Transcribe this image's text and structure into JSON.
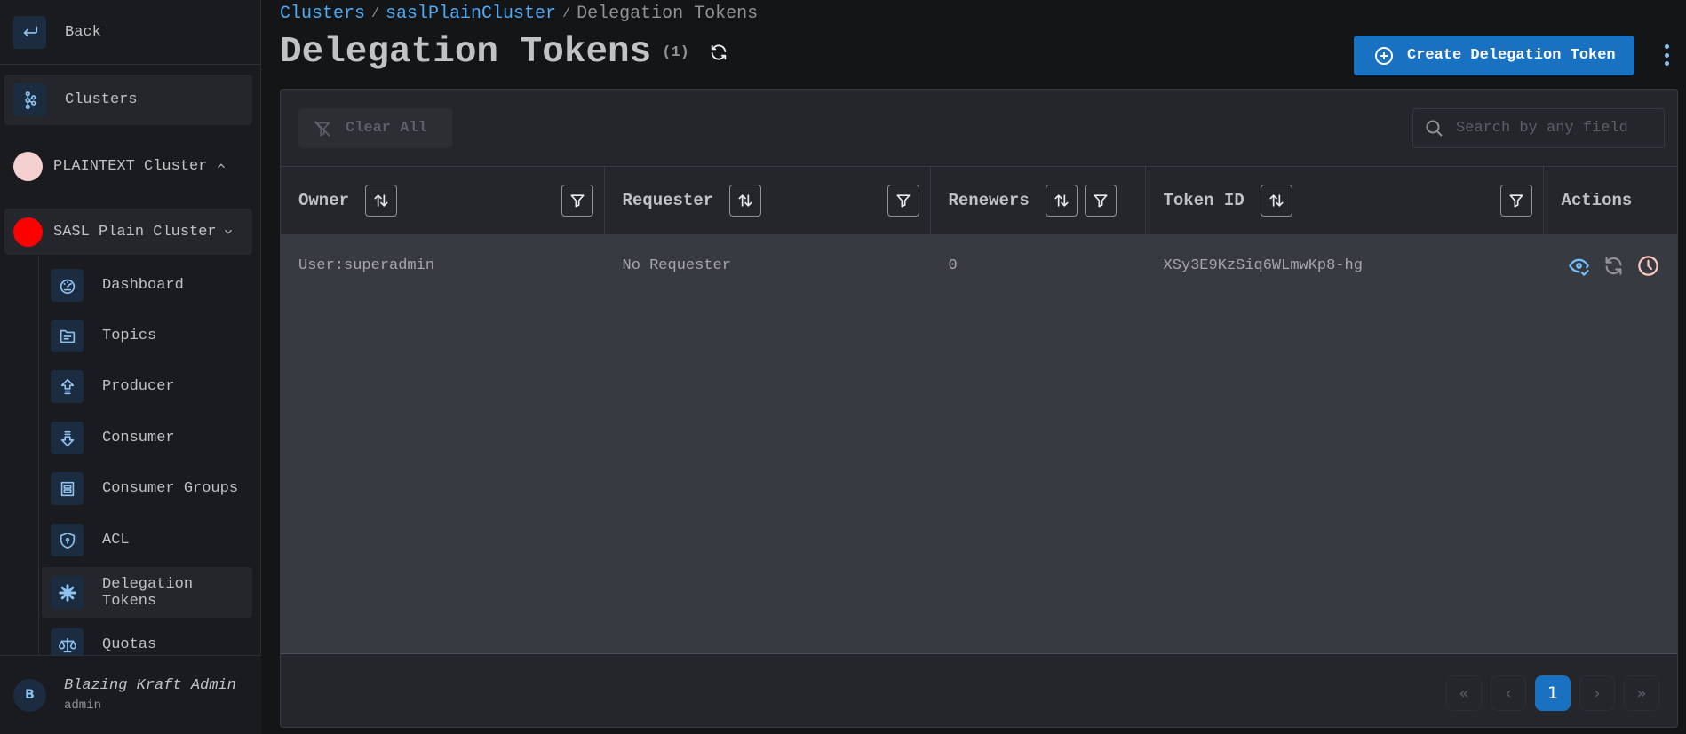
{
  "sidebar": {
    "back_label": "Back",
    "clusters_label": "Clusters",
    "clusters": [
      {
        "name": "PLAINTEXT Cluster",
        "color": "#f5d0d0",
        "expanded": false
      },
      {
        "name": "SASL Plain Cluster",
        "color": "#ff0000",
        "expanded": true
      }
    ],
    "items": [
      {
        "label": "Dashboard",
        "icon": "dashboard-icon"
      },
      {
        "label": "Topics",
        "icon": "folder-icon"
      },
      {
        "label": "Producer",
        "icon": "arrow-up-icon"
      },
      {
        "label": "Consumer",
        "icon": "arrow-down-icon"
      },
      {
        "label": "Consumer Groups",
        "icon": "container-icon"
      },
      {
        "label": "ACL",
        "icon": "shield-lock-icon"
      },
      {
        "label": "Delegation Tokens",
        "icon": "asterisk-icon",
        "active": true
      },
      {
        "label": "Quotas",
        "icon": "scale-icon"
      }
    ],
    "user": {
      "initial": "B",
      "name": "Blazing Kraft Admin",
      "role": "admin"
    }
  },
  "header": {
    "breadcrumb": [
      {
        "label": "Clusters",
        "link": true
      },
      {
        "label": "saslPlainCluster",
        "link": true
      },
      {
        "label": "Delegation Tokens",
        "link": false
      }
    ],
    "separator": "/",
    "title": "Delegation Tokens",
    "count": "(1)",
    "create_label": "Create Delegation Token"
  },
  "toolbar": {
    "clear_label": "Clear All",
    "search_placeholder": "Search by any field",
    "search_value": ""
  },
  "table": {
    "columns": [
      "Owner",
      "Requester",
      "Renewers",
      "Token ID",
      "Actions"
    ],
    "rows": [
      {
        "owner": "User:superadmin",
        "requester": "No Requester",
        "renewers": "0",
        "token_id": "XSy3E9KzSiq6WLmwKp8-hg"
      }
    ],
    "row_actions": [
      "view-icon",
      "renew-icon",
      "expire-icon"
    ]
  },
  "pagination": {
    "first": "«",
    "prev": "‹",
    "current_page": "1",
    "next": "›",
    "last": "»"
  },
  "colors": {
    "accent": "#1971c2",
    "link": "#4dabf7",
    "view_icon": "#74c0fc",
    "renew_icon": "#909296",
    "expire_icon": "#ffc9c0"
  }
}
